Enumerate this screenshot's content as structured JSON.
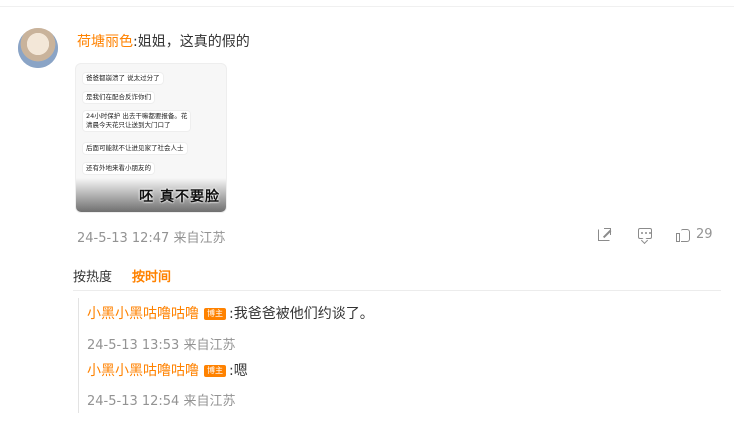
{
  "comment": {
    "username": "荷塘丽色",
    "text": ":姐姐，这真的假的",
    "meta": "24-5-13 12:47 来自江苏",
    "like_count": "29",
    "image": {
      "bubbles": [
        "爸爸都崩溃了 说太过分了",
        "是我们在配合反诈你们",
        "24小时保护 出去干嘛都要报备。花\n清晨今天花只让送到大门口了",
        "后面可能就不让进见家了社会人士",
        "还有外地来看小朋友的"
      ],
      "caption": "呸 真不要脸"
    }
  },
  "sort_tabs": {
    "hot": "按热度",
    "time": "按时间"
  },
  "replies": [
    {
      "username": "小黑小黑咕噜咕噜",
      "badge": "博主",
      "text": ":我爸爸被他们约谈了。",
      "meta": "24-5-13 13:53 来自江苏"
    },
    {
      "username": "小黑小黑咕噜咕噜",
      "badge": "博主",
      "text": ":嗯",
      "meta": "24-5-13 12:54 来自江苏"
    }
  ],
  "colors": {
    "accent": "#ff8200",
    "meta_gray": "#939393"
  },
  "icons": {
    "share": "share-icon",
    "comment": "comment-icon",
    "like": "like-icon"
  }
}
